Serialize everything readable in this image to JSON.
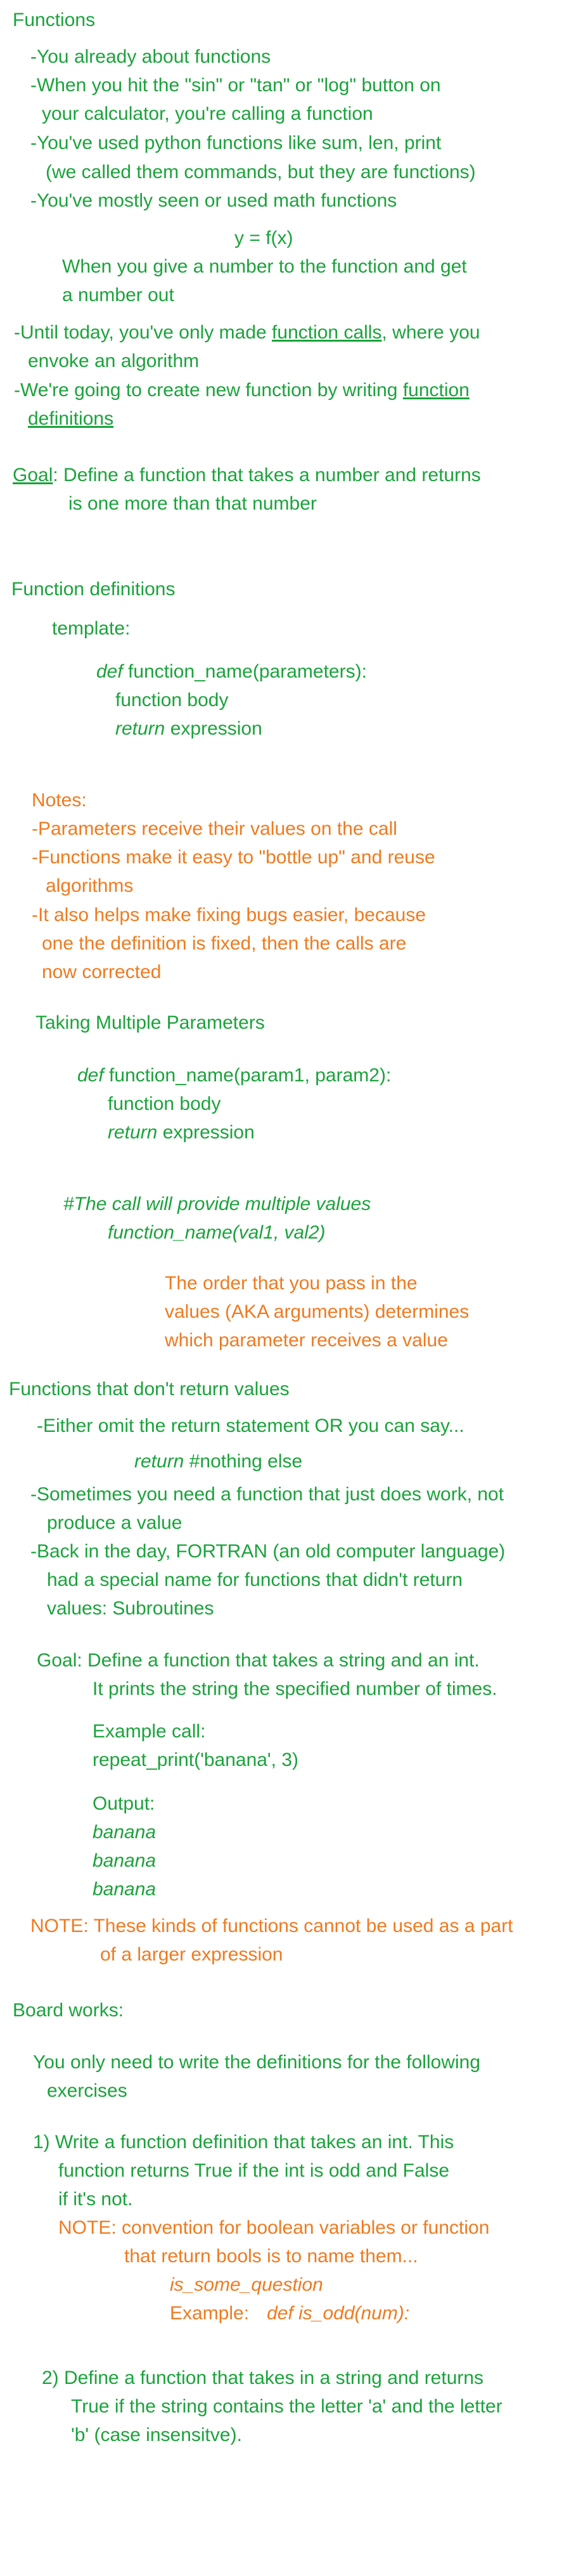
{
  "colors": {
    "green": "#1aa33b",
    "orange": "#f07a1f"
  },
  "section1": {
    "heading": "Functions",
    "l1": "-You already about functions",
    "l2": "-When you hit the \"sin\" or \"tan\" or \"log\" button on",
    "l3": "your calculator, you're calling a function",
    "l4": "-You've used python functions like sum, len, print",
    "l5": "(we called them commands, but they are functions)",
    "l6": "-You've mostly seen or used math functions",
    "formula": "y = f(x)",
    "l7": "When you give a number to the function and get",
    "l8": "a number out",
    "l9_pre": "-Until today, you've only made ",
    "l9_link": "function calls",
    "l9_post": ", where you",
    "l10": "envoke an algorithm",
    "l11_pre": "-We're going to create new function by writing ",
    "l11_link": "function",
    "l12_link": "definitions",
    "goal_label": "Goal",
    "goal_text": ": Define a function that takes a number and returns",
    "goal_text2": "is one more than that number"
  },
  "section2": {
    "heading": "Function definitions",
    "template_label": "template:",
    "def_kw": "def",
    "def_sig": " function_name(parameters):",
    "body": "function body",
    "return_kw": "return",
    "return_expr": " expression",
    "notes_label": "Notes:",
    "n1": "-Parameters receive their values on the call",
    "n2": "-Functions make it easy to \"bottle up\" and reuse",
    "n3": "algorithms",
    "n4": "-It also helps make fixing bugs easier, because",
    "n5": "one the definition is fixed, then the calls are",
    "n6": "now corrected",
    "multi_heading": "Taking Multiple Parameters",
    "multi_def_kw": "def",
    "multi_def_sig": " function_name(param1, param2):",
    "multi_body": "function body",
    "multi_return_kw": "return",
    "multi_return_expr": " expression",
    "comment": "#The call will provide multiple values",
    "call": "function_name(val1, val2)",
    "order1": "The order that you pass in the",
    "order2": "values (AKA arguments) determines",
    "order3": "which parameter receives a value"
  },
  "section3": {
    "heading": "Functions that don't return values",
    "l1": "-Either omit the return statement OR you can say...",
    "ret_kw": "return",
    "ret_rest": " #nothing else",
    "l2": "-Sometimes you need a function that just does work, not",
    "l3": "produce a value",
    "l4": "-Back in the day, FORTRAN (an old computer language)",
    "l5": "had a special name for functions that didn't return",
    "l6": "values:  Subroutines",
    "goal1": "Goal: Define a function that takes a string and an int.",
    "goal2": "It prints the string the specified number of times.",
    "example_label": "Example call:",
    "example_call": "repeat_print('banana', 3)",
    "output_label": "Output:",
    "out1": "banana",
    "out2": "banana",
    "out3": "banana",
    "note1": "NOTE: These kinds of functions cannot be used as a part",
    "note2": "of a larger expression"
  },
  "section4": {
    "heading": "Board works:",
    "intro1": "You only need to write the definitions for the following",
    "intro2": "exercises",
    "e1_1": "1) Write a function definition that takes an int. This",
    "e1_2": "function returns True if the int is odd and False",
    "e1_3": "if it's not.",
    "e1_note1": "NOTE: convention for boolean variables or function",
    "e1_note2": "that return bools is to name them...",
    "e1_name": "is_some_question",
    "e1_example_label": "Example:",
    "e1_example_code": "def is_odd(num):",
    "e2_1": "2) Define a function that takes in a string and returns",
    "e2_2": "True if the string contains the letter 'a' and the letter",
    "e2_3": "'b' (case insensitve)."
  }
}
